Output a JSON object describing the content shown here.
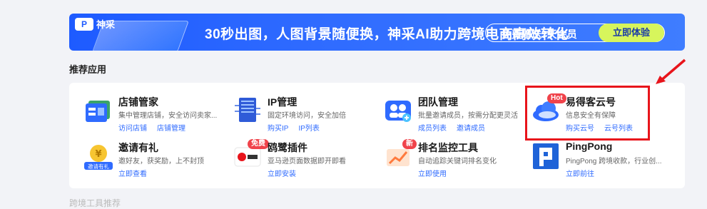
{
  "banner": {
    "headline": "30秒出图，人图背景随便换，神采AI助力跨境电商高效转化",
    "offer": "免费赠送7天会员",
    "cta": "立即体验",
    "brand": "神采"
  },
  "section": {
    "title": "推荐应用"
  },
  "apps": [
    {
      "name": "店铺管家",
      "desc": "集中管理店铺，安全访问卖家...",
      "links": [
        "访问店铺",
        "店铺管理"
      ],
      "badge": ""
    },
    {
      "name": "IP管理",
      "desc": "固定环境访问，安全加倍",
      "links": [
        "购买IP",
        "IP列表"
      ],
      "badge": ""
    },
    {
      "name": "团队管理",
      "desc": "批量邀请成员，按需分配更灵活",
      "links": [
        "成员列表",
        "邀请成员"
      ],
      "badge": ""
    },
    {
      "name": "易得客云号",
      "desc": "信息安全有保障",
      "links": [
        "购买云号",
        "云号列表"
      ],
      "badge": "Hot"
    },
    {
      "name": "邀请有礼",
      "desc": "邀好友，获奖励，上不封顶",
      "links": [
        "立即查看"
      ],
      "badge": "",
      "icon_label": "邀请有礼"
    },
    {
      "name": "鸥鹭插件",
      "desc": "亚马逊页面数据即开即看",
      "links": [
        "立即安装"
      ],
      "badge": "免费"
    },
    {
      "name": "排名监控工具",
      "desc": "自动追踪关键词排名变化",
      "links": [
        "立即使用"
      ],
      "badge": "新"
    },
    {
      "name": "PingPong",
      "desc": "PingPong 跨境收款，行业创...",
      "links": [
        "立即前往"
      ],
      "badge": ""
    }
  ],
  "colors": {
    "accent": "#2f6bff",
    "highlight": "#e8141b",
    "badge_red": "#f0434b"
  },
  "footer": {
    "partial_text": "跨境工具推荐"
  }
}
